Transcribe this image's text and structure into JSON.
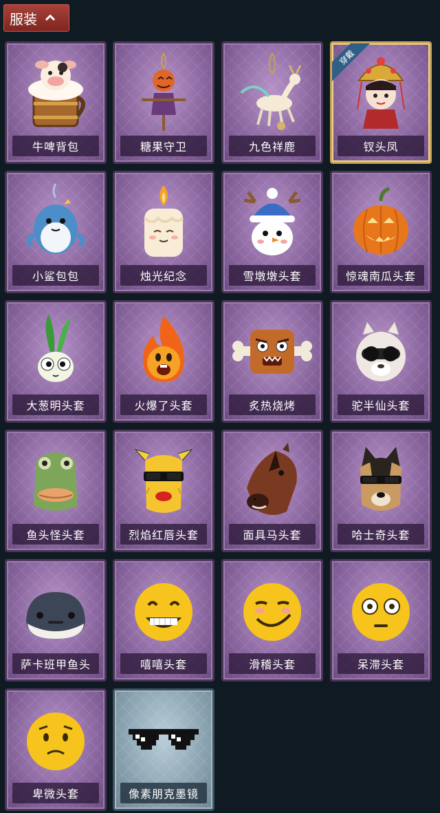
{
  "header": {
    "title": "服装",
    "icon": "chevron-up-icon"
  },
  "items": [
    {
      "label": "牛啤背包",
      "icon": "cow-beer-backpack-icon"
    },
    {
      "label": "糖果守卫",
      "icon": "pumpkin-scarecrow-icon"
    },
    {
      "label": "九色祥鹿",
      "icon": "deer-pendant-icon"
    },
    {
      "label": "钗头凤",
      "icon": "phoenix-crown-icon",
      "badge": "穿戴"
    },
    {
      "label": "小鲨包包",
      "icon": "shark-bag-icon"
    },
    {
      "label": "烛光纪念",
      "icon": "candle-icon"
    },
    {
      "label": "雪墩墩头套",
      "icon": "snowman-head-icon"
    },
    {
      "label": "惊魂南瓜头套",
      "icon": "pumpkin-head-icon"
    },
    {
      "label": "大葱明头套",
      "icon": "scallion-head-icon"
    },
    {
      "label": "火爆了头套",
      "icon": "fire-head-icon"
    },
    {
      "label": "炙热烧烤",
      "icon": "bbq-meat-icon"
    },
    {
      "label": "驼半仙头套",
      "icon": "alpaca-head-icon"
    },
    {
      "label": "鱼头怪头套",
      "icon": "fish-head-icon"
    },
    {
      "label": "烈焰红唇头套",
      "icon": "red-lips-head-icon"
    },
    {
      "label": "面具马头套",
      "icon": "horse-mask-icon"
    },
    {
      "label": "哈士奇头套",
      "icon": "husky-head-icon"
    },
    {
      "label": "萨卡班甲鱼头",
      "icon": "sacabambaspis-head-icon"
    },
    {
      "label": "嘻嘻头套",
      "icon": "grin-emoji-head-icon"
    },
    {
      "label": "滑稽头套",
      "icon": "funny-emoji-head-icon"
    },
    {
      "label": "呆滞头套",
      "icon": "dazed-emoji-head-icon"
    },
    {
      "label": "卑微头套",
      "icon": "humble-emoji-head-icon"
    },
    {
      "label": "像素朋克墨镜",
      "icon": "pixel-sunglasses-icon",
      "rarity": "silver"
    }
  ]
}
